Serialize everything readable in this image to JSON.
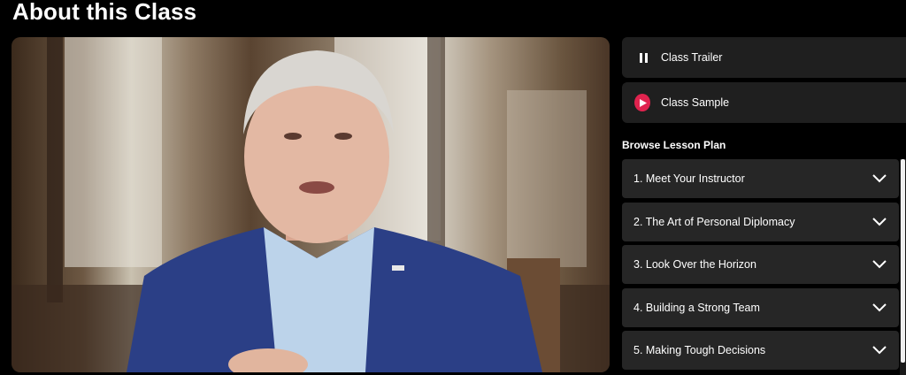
{
  "page": {
    "title": "About this Class"
  },
  "video": {
    "description_icon": "video-player"
  },
  "side_buttons": [
    {
      "label": "Class Trailer",
      "icon": "pause-icon"
    },
    {
      "label": "Class Sample",
      "icon": "play-icon"
    }
  ],
  "lesson_plan": {
    "heading": "Browse Lesson Plan",
    "items": [
      {
        "label": "1. Meet Your Instructor"
      },
      {
        "label": "2. The Art of Personal Diplomacy"
      },
      {
        "label": "3. Look Over the Horizon"
      },
      {
        "label": "4. Building a Strong Team"
      },
      {
        "label": "5. Making Tough Decisions"
      }
    ]
  },
  "colors": {
    "accent": "#e0234e",
    "panel": "#1f1f1f",
    "item": "#262626"
  }
}
